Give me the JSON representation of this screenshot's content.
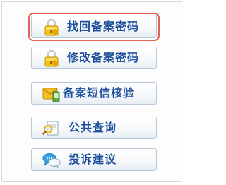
{
  "menu": {
    "items": [
      {
        "label": "找回备案密码",
        "icon": "lock-icon",
        "active": true
      },
      {
        "label": "修改备案密码",
        "icon": "lock-icon",
        "active": false
      },
      {
        "label": "备案短信核验",
        "icon": "sms-envelope-icon",
        "active": false
      },
      {
        "label": "公共查询",
        "icon": "search-document-icon",
        "active": false
      },
      {
        "label": "投诉建议",
        "icon": "chat-bubbles-icon",
        "active": false
      }
    ]
  },
  "colors": {
    "label": "#1d4f9c",
    "active_outline": "#e8604f",
    "button_border": "#b9c9da"
  }
}
